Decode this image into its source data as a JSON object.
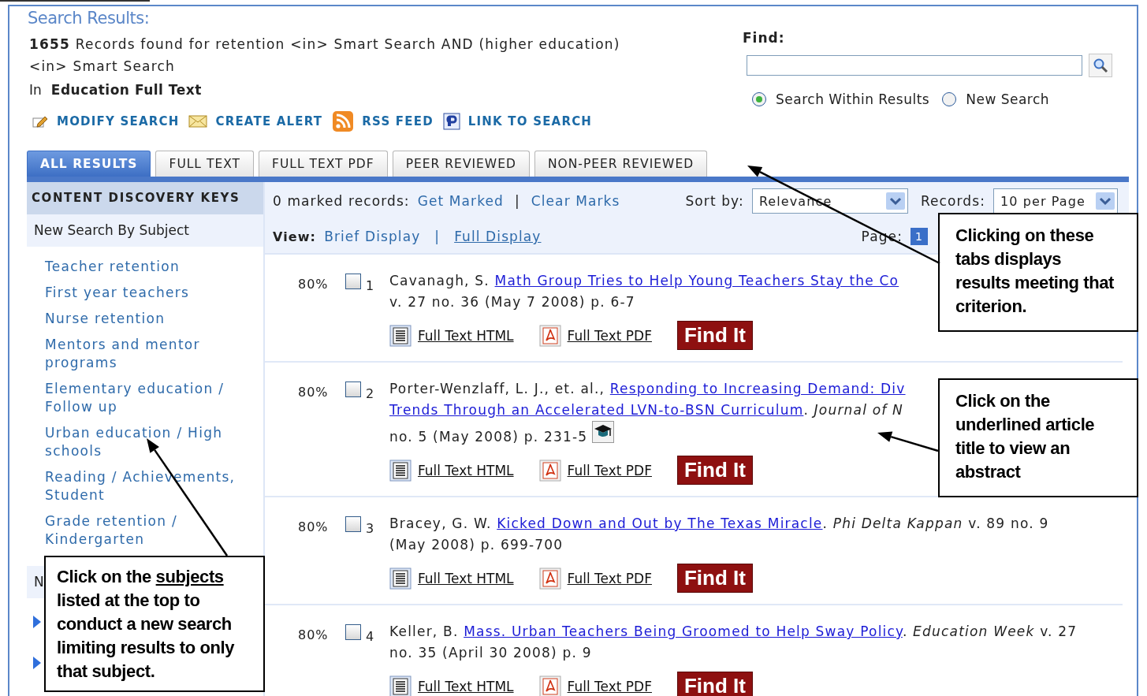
{
  "header": {
    "title": "Search Results:",
    "count": "1655",
    "query": "Records found for retention <in> Smart Search AND (higher education) <in> Smart Search",
    "database_prefix": "In",
    "database": "Education Full Text"
  },
  "actions": [
    {
      "kind": "modify",
      "label": "MODIFY SEARCH"
    },
    {
      "kind": "alert",
      "label": "CREATE ALERT"
    },
    {
      "kind": "rss",
      "label": "RSS FEED"
    },
    {
      "kind": "link",
      "label": "LINK TO SEARCH"
    }
  ],
  "find": {
    "label": "Find:",
    "scopes": [
      {
        "label": "Search Within Results",
        "selected": true
      },
      {
        "label": "New Search",
        "selected": false
      }
    ]
  },
  "tabs": [
    {
      "label": "ALL RESULTS",
      "selected": true
    },
    {
      "label": "FULL TEXT",
      "selected": false
    },
    {
      "label": "FULL TEXT PDF",
      "selected": false
    },
    {
      "label": "PEER REVIEWED",
      "selected": false
    },
    {
      "label": "NON-PEER REVIEWED",
      "selected": false
    }
  ],
  "sidebar": {
    "title": "CONTENT DISCOVERY KEYS",
    "subtitle": "New Search By Subject",
    "subjects": [
      "Teacher retention",
      "First year teachers",
      "Nurse retention",
      "Mentors and mentor programs",
      "Elementary education / Follow up",
      "Urban education / High schools",
      "Reading / Achievements, Student",
      "Grade retention / Kindergarten"
    ],
    "next_heading": "N"
  },
  "toolbar": {
    "marked": "0 marked records:",
    "get_marked": "Get Marked",
    "separator": "|",
    "clear_marks": "Clear Marks",
    "sort_label": "Sort by:",
    "sort_value": "Relevance",
    "records_label": "Records:",
    "records_value": "10 per Page",
    "view_label": "View:",
    "brief": "Brief Display",
    "view_separator": "|",
    "full": "Full Display",
    "page_label": "Page:",
    "page": "1"
  },
  "results": [
    {
      "score": "80%",
      "checked": false,
      "number": "1",
      "peer_reviewed": false,
      "lines": [
        [
          {
            "kind": "author",
            "text": "Cavanagh, S."
          },
          {
            "kind": "title",
            "text": "Math Group Tries to Help Young Teachers Stay the Co"
          }
        ],
        [
          {
            "kind": "text",
            "text": "v. 27 no. 36 (May 7 2008) p. 6-7"
          }
        ]
      ],
      "links": [
        "Full Text HTML",
        "Full Text PDF"
      ],
      "find_it": "Find It"
    },
    {
      "score": "80%",
      "checked": false,
      "number": "2",
      "peer_reviewed": true,
      "lines": [
        [
          {
            "kind": "author",
            "text": "Porter-Wenzlaff, L. J., et. al.,"
          },
          {
            "kind": "title",
            "text": "Responding to Increasing Demand: Div"
          }
        ],
        [
          {
            "kind": "title",
            "text": "Trends Through an Accelerated LVN-to-BSN Curriculum"
          },
          {
            "kind": "text",
            "text": ".",
            "joined": true
          },
          {
            "kind": "journal",
            "text": "Journal of N"
          }
        ],
        [
          {
            "kind": "text",
            "text": "no. 5 (May 2008) p. 231-5"
          }
        ]
      ],
      "links": [
        "Full Text HTML",
        "Full Text PDF"
      ],
      "find_it": "Find It"
    },
    {
      "score": "80%",
      "checked": false,
      "number": "3",
      "peer_reviewed": false,
      "lines": [
        [
          {
            "kind": "author",
            "text": "Bracey, G. W."
          },
          {
            "kind": "title",
            "text": "Kicked Down and Out by The Texas Miracle"
          },
          {
            "kind": "text",
            "text": ".",
            "joined": true
          },
          {
            "kind": "journal",
            "text": "Phi Delta Kappan"
          },
          {
            "kind": "text",
            "text": "v. 89 no. 9"
          }
        ],
        [
          {
            "kind": "text",
            "text": "(May 2008) p. 699-700"
          }
        ]
      ],
      "links": [
        "Full Text HTML",
        "Full Text PDF"
      ],
      "find_it": "Find It"
    },
    {
      "score": "80%",
      "checked": false,
      "number": "4",
      "peer_reviewed": false,
      "lines": [
        [
          {
            "kind": "author",
            "text": "Keller, B."
          },
          {
            "kind": "title",
            "text": "Mass. Urban Teachers Being Groomed to Help Sway Policy"
          },
          {
            "kind": "text",
            "text": ".",
            "joined": true
          },
          {
            "kind": "journal",
            "text": "Education Week"
          },
          {
            "kind": "text",
            "text": "v. 27"
          }
        ],
        [
          {
            "kind": "text",
            "text": "no. 35 (April 30 2008) p. 9"
          }
        ]
      ],
      "links": [
        "Full Text HTML",
        "Full Text PDF"
      ],
      "find_it": "Find It"
    }
  ],
  "callouts": [
    {
      "kind": "tabs",
      "lines": [
        [
          {
            "text": "Clicking on these",
            "underlined": false
          }
        ],
        [
          {
            "text": "tabs displays",
            "underlined": false
          }
        ],
        [
          {
            "text": "results meeting that",
            "underlined": false
          }
        ],
        [
          {
            "text": "criterion.",
            "underlined": false
          }
        ]
      ]
    },
    {
      "kind": "title",
      "lines": [
        [
          {
            "text": "Click on the",
            "underlined": false
          }
        ],
        [
          {
            "text": "underlined article",
            "underlined": false
          }
        ],
        [
          {
            "text": "title to view an",
            "underlined": false
          }
        ],
        [
          {
            "text": "abstract",
            "underlined": false
          }
        ]
      ]
    },
    {
      "kind": "subjects",
      "lines": [
        [
          {
            "text": "Click on the",
            "underlined": false
          },
          {
            "text": "subjects",
            "underlined": true
          }
        ],
        [
          {
            "text": "listed at the top to",
            "underlined": false
          }
        ],
        [
          {
            "text": "conduct a new search",
            "underlined": false
          }
        ],
        [
          {
            "text": "limiting results to only",
            "underlined": false
          }
        ],
        [
          {
            "text": "that subject.",
            "underlined": false
          }
        ]
      ]
    }
  ]
}
